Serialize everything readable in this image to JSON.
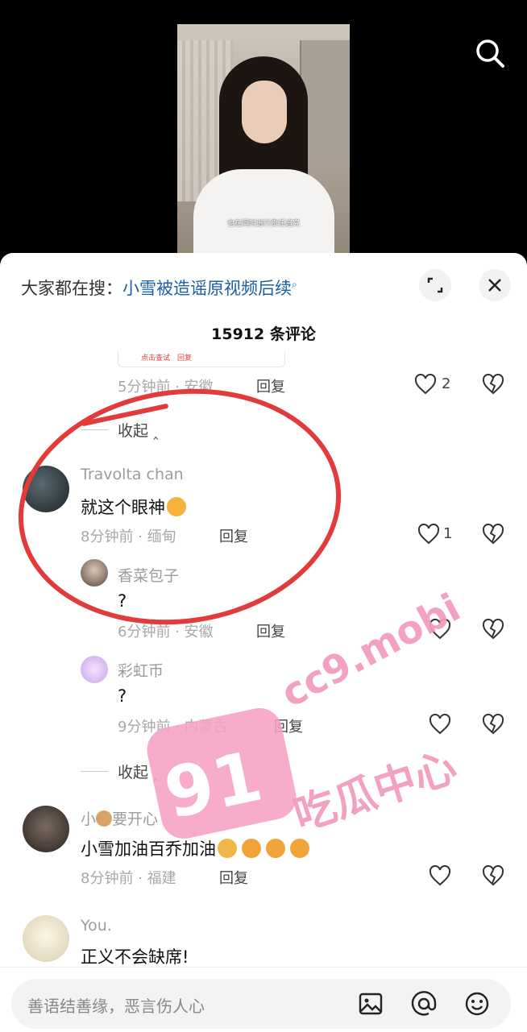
{
  "video": {
    "subtitle": "也在同时进行责任追究"
  },
  "panel": {
    "search_prefix": "大家都在搜：",
    "search_link": "小雪被造谣原视频后续",
    "comment_count": "15912 条评论"
  },
  "comments": [
    {
      "meta": "5分钟前 · 安徽",
      "reply": "回复",
      "likes": "2",
      "snippet": "点击查试　回复"
    },
    {
      "collapse": "收起"
    },
    {
      "name": "Travolta chan",
      "text": "就这个眼神",
      "meta": "8分钟前 · 缅甸",
      "reply": "回复",
      "likes": "1"
    },
    {
      "name": "香菜包子",
      "text": "?",
      "meta": "6分钟前 · 安徽",
      "reply": "回复"
    },
    {
      "name": "彩虹币",
      "text": "?",
      "meta": "9分钟前 · 内蒙古",
      "reply": "回复"
    },
    {
      "collapse": "收起"
    },
    {
      "name_a": "小",
      "name_b": "要开心",
      "text": "小雪加油百乔加油",
      "meta": "8分钟前 · 福建",
      "reply": "回复"
    },
    {
      "name": "You.",
      "text": "正义不会缺席!"
    }
  ],
  "watermark": {
    "num": "91",
    "url": "cc9.mobi",
    "cn": "吃瓜中心"
  },
  "input": {
    "placeholder": "善语结善缘，恶言伤人心"
  },
  "colors": {
    "accent_link": "#1a5fa8",
    "circle": "#e23b3b",
    "watermark": "#f39abd"
  }
}
